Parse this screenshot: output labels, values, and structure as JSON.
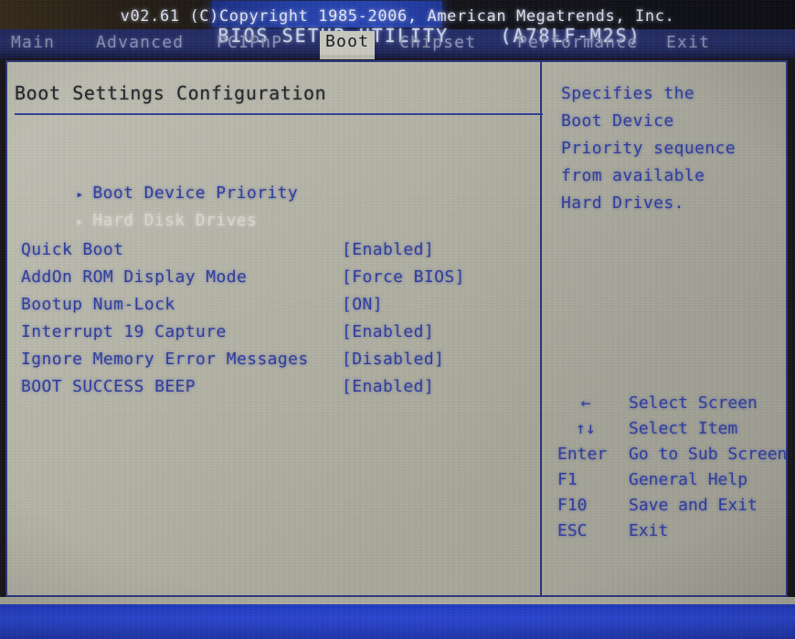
{
  "header": {
    "title": "BIOS SETUP UTILITY",
    "model": "(A78LF-M2S)"
  },
  "menubar": {
    "items": [
      {
        "label": "Main",
        "active": false
      },
      {
        "label": "Advanced",
        "active": false
      },
      {
        "label": "PCIPnP",
        "active": false
      },
      {
        "label": "Boot",
        "active": true
      },
      {
        "label": "Chipset",
        "active": false
      },
      {
        "label": "Performance",
        "active": false
      },
      {
        "label": "Exit",
        "active": false
      }
    ]
  },
  "main": {
    "page_title": "Boot Settings Configuration",
    "submenus": [
      {
        "arrow": "▸",
        "label": "Boot Device Priority",
        "selected": true
      },
      {
        "arrow": "▸",
        "label": "Hard Disk Drives",
        "selected": false
      }
    ],
    "settings": [
      {
        "label": "Quick Boot",
        "value": "[Enabled]"
      },
      {
        "label": "AddOn ROM Display Mode",
        "value": "[Force BIOS]"
      },
      {
        "label": "Bootup Num-Lock",
        "value": "[ON]"
      },
      {
        "label": "Interrupt 19 Capture",
        "value": "[Enabled]"
      },
      {
        "label": "Ignore Memory Error Messages",
        "value": "[Disabled]"
      },
      {
        "label": "BOOT SUCCESS BEEP",
        "value": "[Enabled]"
      }
    ]
  },
  "help": {
    "lines": [
      "Specifies the",
      "Boot Device",
      "Priority sequence",
      "from available",
      "Hard Drives."
    ]
  },
  "navlegend": {
    "rows": [
      {
        "key": "←",
        "action": "Select Screen",
        "centered": true
      },
      {
        "key": "↑↓",
        "action": "Select Item",
        "centered": true
      },
      {
        "key": "Enter",
        "action": "Go to Sub Screen",
        "centered": false
      },
      {
        "key": "F1",
        "action": "General Help",
        "centered": false
      },
      {
        "key": "F10",
        "action": "Save and Exit",
        "centered": false
      },
      {
        "key": "ESC",
        "action": "Exit",
        "centered": false
      }
    ]
  },
  "footer": {
    "text": "v02.61 (C)Copyright 1985-2006, American Megatrends, Inc."
  },
  "colors": {
    "screen_bg": "#b4b4a6",
    "text_blue": "#2e3c9e",
    "frame_blue": "#2b3480",
    "menubar_blue": "#252d68",
    "footer_blue": "#2a46d2",
    "title_hl_blue": "#2340aa",
    "active_tab_bg": "#c9c9c0",
    "dim_text": "#d8d8d0"
  }
}
